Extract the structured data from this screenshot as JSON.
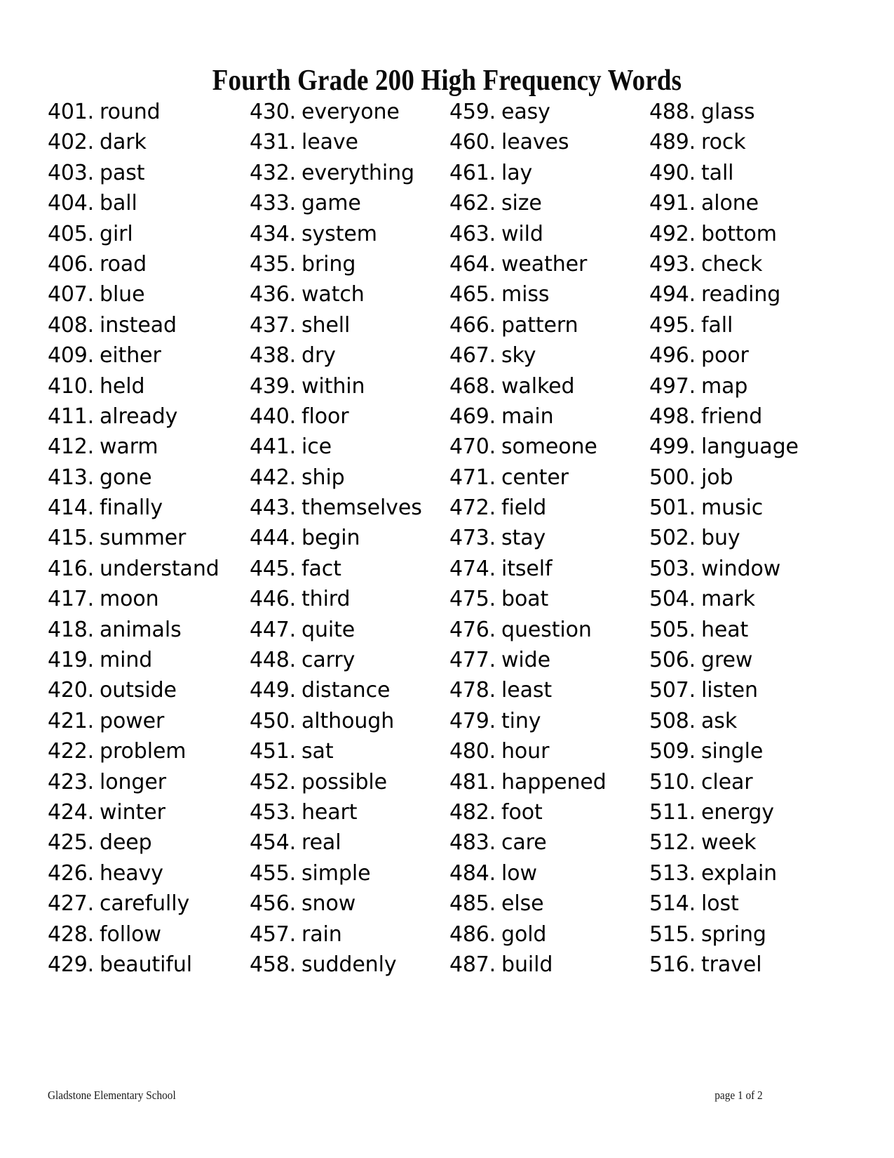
{
  "document": {
    "title": "Fourth Grade 200 High Frequency Words",
    "footer_left": "Gladstone Elementary School",
    "footer_right": "page 1 of 2"
  },
  "columns": [
    {
      "id": "column-1",
      "entries": [
        {
          "num": "401.",
          "word": "round"
        },
        {
          "num": "402.",
          "word": "dark"
        },
        {
          "num": "403.",
          "word": "past"
        },
        {
          "num": "404.",
          "word": "ball"
        },
        {
          "num": "405.",
          "word": "girl"
        },
        {
          "num": "406.",
          "word": "road"
        },
        {
          "num": "407.",
          "word": "blue"
        },
        {
          "num": "408.",
          "word": "instead"
        },
        {
          "num": "409.",
          "word": "either"
        },
        {
          "num": "410.",
          "word": "held"
        },
        {
          "num": "411.",
          "word": "already"
        },
        {
          "num": "412.",
          "word": "warm"
        },
        {
          "num": "413.",
          "word": "gone"
        },
        {
          "num": "414.",
          "word": "finally"
        },
        {
          "num": "415.",
          "word": "summer"
        },
        {
          "num": "416.",
          "word": "understand"
        },
        {
          "num": "417.",
          "word": "moon"
        },
        {
          "num": "418.",
          "word": "animals"
        },
        {
          "num": "419.",
          "word": "mind"
        },
        {
          "num": "420.",
          "word": "outside"
        },
        {
          "num": "421.",
          "word": "power"
        },
        {
          "num": "422.",
          "word": "problem"
        },
        {
          "num": "423.",
          "word": "longer"
        },
        {
          "num": "424.",
          "word": "winter"
        },
        {
          "num": "425.",
          "word": "deep"
        },
        {
          "num": "426.",
          "word": "heavy"
        },
        {
          "num": "427.",
          "word": "carefully"
        },
        {
          "num": "428.",
          "word": "follow"
        },
        {
          "num": "429.",
          "word": "beautiful"
        }
      ]
    },
    {
      "id": "column-2",
      "entries": [
        {
          "num": "430.",
          "word": "everyone"
        },
        {
          "num": "431.",
          "word": "leave"
        },
        {
          "num": "432.",
          "word": "everything"
        },
        {
          "num": "433.",
          "word": "game"
        },
        {
          "num": "434.",
          "word": "system"
        },
        {
          "num": "435.",
          "word": "bring"
        },
        {
          "num": "436.",
          "word": "watch"
        },
        {
          "num": "437.",
          "word": "shell"
        },
        {
          "num": "438.",
          "word": "dry"
        },
        {
          "num": "439.",
          "word": "within"
        },
        {
          "num": "440.",
          "word": "floor"
        },
        {
          "num": "441.",
          "word": "ice"
        },
        {
          "num": "442.",
          "word": "ship"
        },
        {
          "num": "443.",
          "word": "themselves"
        },
        {
          "num": "444.",
          "word": "begin"
        },
        {
          "num": "445.",
          "word": "fact"
        },
        {
          "num": "446.",
          "word": "third"
        },
        {
          "num": "447.",
          "word": "quite"
        },
        {
          "num": "448.",
          "word": "carry"
        },
        {
          "num": "449.",
          "word": "distance"
        },
        {
          "num": "450.",
          "word": "although"
        },
        {
          "num": "451.",
          "word": "sat"
        },
        {
          "num": "452.",
          "word": "possible"
        },
        {
          "num": "453.",
          "word": "heart"
        },
        {
          "num": "454.",
          "word": "real"
        },
        {
          "num": "455.",
          "word": "simple"
        },
        {
          "num": "456.",
          "word": "snow"
        },
        {
          "num": "457.",
          "word": "rain"
        },
        {
          "num": "458.",
          "word": "suddenly"
        }
      ]
    },
    {
      "id": "column-3",
      "entries": [
        {
          "num": "459.",
          "word": "easy"
        },
        {
          "num": "460.",
          "word": "leaves"
        },
        {
          "num": "461.",
          "word": "lay"
        },
        {
          "num": "462.",
          "word": "size"
        },
        {
          "num": "463.",
          "word": "wild"
        },
        {
          "num": "464.",
          "word": "weather"
        },
        {
          "num": "465.",
          "word": "miss"
        },
        {
          "num": "466.",
          "word": "pattern"
        },
        {
          "num": "467.",
          "word": "sky"
        },
        {
          "num": "468.",
          "word": "walked"
        },
        {
          "num": "469.",
          "word": "main"
        },
        {
          "num": "470.",
          "word": "someone"
        },
        {
          "num": "471.",
          "word": "center"
        },
        {
          "num": "472.",
          "word": "field"
        },
        {
          "num": "473.",
          "word": "stay"
        },
        {
          "num": "474.",
          "word": "itself"
        },
        {
          "num": "475.",
          "word": "boat"
        },
        {
          "num": "476.",
          "word": "question"
        },
        {
          "num": "477.",
          "word": "wide"
        },
        {
          "num": "478.",
          "word": "least"
        },
        {
          "num": "479.",
          "word": "tiny"
        },
        {
          "num": "480.",
          "word": "hour"
        },
        {
          "num": "481.",
          "word": "happened"
        },
        {
          "num": "482.",
          "word": "foot"
        },
        {
          "num": "483.",
          "word": "care"
        },
        {
          "num": "484.",
          "word": "low"
        },
        {
          "num": "485.",
          "word": "else"
        },
        {
          "num": "486.",
          "word": "gold"
        },
        {
          "num": "487.",
          "word": "build"
        }
      ]
    },
    {
      "id": "column-4",
      "entries": [
        {
          "num": "488.",
          "word": "glass"
        },
        {
          "num": "489.",
          "word": "rock"
        },
        {
          "num": "490.",
          "word": "tall"
        },
        {
          "num": "491.",
          "word": "alone"
        },
        {
          "num": "492.",
          "word": "bottom"
        },
        {
          "num": "493.",
          "word": "check"
        },
        {
          "num": "494.",
          "word": "reading"
        },
        {
          "num": "495.",
          "word": "fall"
        },
        {
          "num": "496.",
          "word": "poor"
        },
        {
          "num": "497.",
          "word": "map"
        },
        {
          "num": "498.",
          "word": "friend"
        },
        {
          "num": "499.",
          "word": "language"
        },
        {
          "num": "500.",
          "word": "job"
        },
        {
          "num": "501.",
          "word": "music"
        },
        {
          "num": "502.",
          "word": "buy"
        },
        {
          "num": "503.",
          "word": "window"
        },
        {
          "num": "504.",
          "word": "mark"
        },
        {
          "num": "505.",
          "word": "heat"
        },
        {
          "num": "506.",
          "word": "grew"
        },
        {
          "num": "507.",
          "word": "listen"
        },
        {
          "num": "508.",
          "word": "ask"
        },
        {
          "num": "509.",
          "word": "single"
        },
        {
          "num": "510.",
          "word": "clear"
        },
        {
          "num": "511.",
          "word": "energy"
        },
        {
          "num": "512.",
          "word": "week"
        },
        {
          "num": "513.",
          "word": "explain"
        },
        {
          "num": "514.",
          "word": "lost"
        },
        {
          "num": "515.",
          "word": "spring"
        },
        {
          "num": "516.",
          "word": "travel"
        }
      ]
    }
  ]
}
